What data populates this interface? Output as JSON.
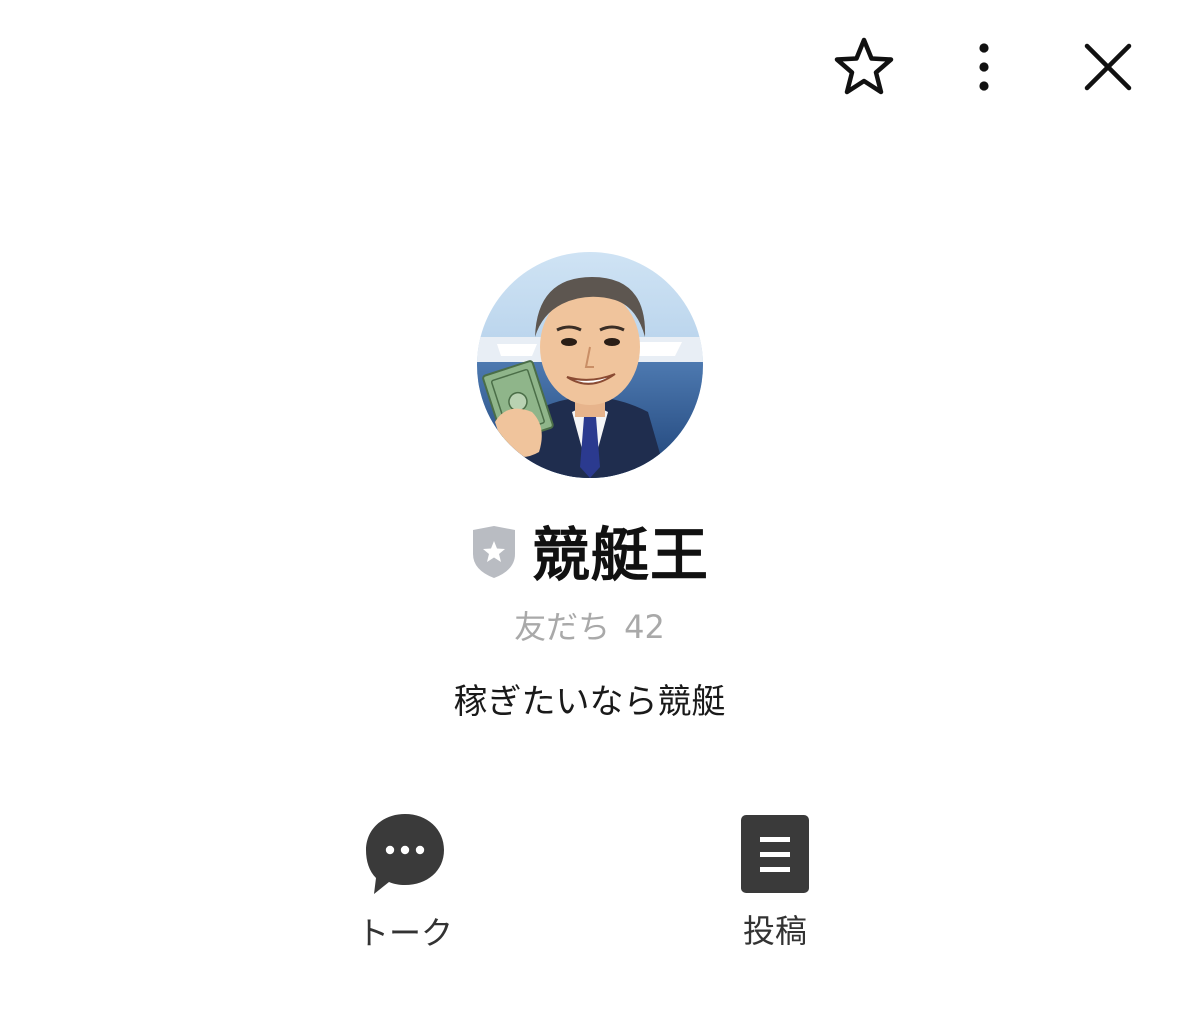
{
  "header": {
    "icons": [
      "star-outline-icon",
      "more-vertical-icon",
      "close-icon"
    ]
  },
  "profile": {
    "name": "競艇王",
    "friends_label": "友だち",
    "friends_count": "42",
    "status_message": "稼ぎたいなら競艇",
    "badge_icon": "shield-star-icon",
    "badge_color": "#b9bcc2"
  },
  "actions": [
    {
      "label": "トーク",
      "icon": "chat-bubble-icon"
    },
    {
      "label": "投稿",
      "icon": "post-list-icon"
    }
  ],
  "colors": {
    "background": "#ffffff",
    "action_icon": "#3a3a3a",
    "muted_text": "#a9a9a9"
  }
}
